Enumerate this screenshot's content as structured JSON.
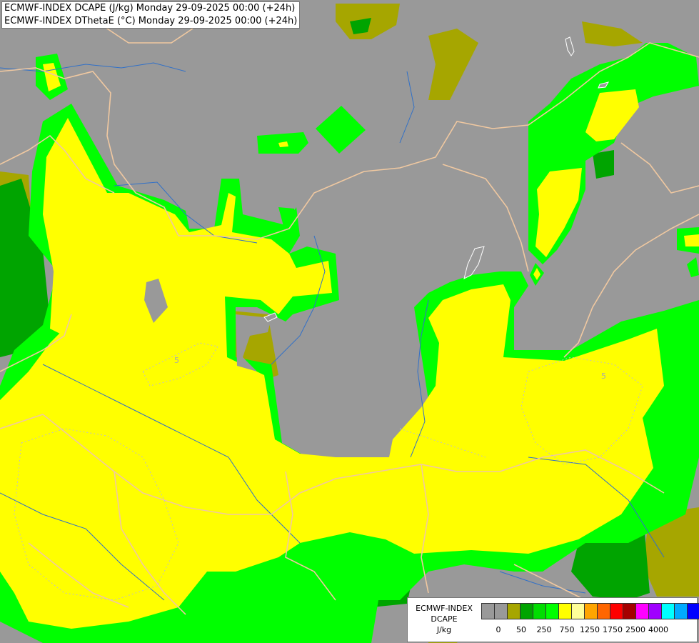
{
  "header": {
    "line1": "ECMWF-INDEX DCAPE (J/kg) Monday 29-09-2025 00:00 (+24h)",
    "line2": "ECMWF-INDEX DThetaE (°C) Monday 29-09-2025 00:00 (+24h)"
  },
  "map": {
    "contour_labels": [
      "5",
      "5"
    ],
    "colors": {
      "background": "#999999",
      "olive": "#a6a600",
      "dark_green": "#00a400",
      "green": "#00ff00",
      "yellow": "#ffff00",
      "border": "#f0c8a0",
      "river": "#3070c8"
    }
  },
  "legend": {
    "title_lines": [
      "ECMWF-INDEX",
      "DCAPE",
      "J/kg"
    ],
    "tick_labels": [
      "0",
      "50",
      "250",
      "750",
      "1250",
      "1750",
      "2500",
      "4000"
    ],
    "colors": [
      "#999999",
      "#999999",
      "#a6a600",
      "#00a400",
      "#00dd00",
      "#00ff00",
      "#ffff00",
      "#ffff99",
      "#ffa500",
      "#ff6600",
      "#ff0000",
      "#a50000",
      "#ff00ff",
      "#a000ff",
      "#00ffff",
      "#00aaff",
      "#0000ff",
      "#00008b"
    ]
  }
}
